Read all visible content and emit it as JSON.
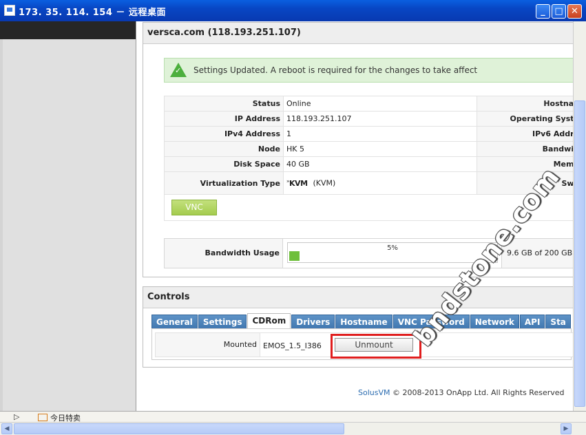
{
  "window": {
    "title": "173. 35. 114. 154 － 远程桌面"
  },
  "server": {
    "heading": "versca.com (118.193.251.107)"
  },
  "alert": {
    "message": "Settings Updated. A reboot is required for the changes to take affect"
  },
  "info_rows": [
    {
      "label": "Status",
      "value": "Online",
      "right_label": "Hostnan"
    },
    {
      "label": "IP Address",
      "value": "118.193.251.107",
      "right_label": "Operating Syste"
    },
    {
      "label": "IPv4 Address",
      "value": "1",
      "right_label": "IPv6 Addre"
    },
    {
      "label": "Node",
      "value": "HK 5",
      "right_label": "Bandwid"
    },
    {
      "label": "Disk Space",
      "value": "40 GB",
      "right_label": "Memo"
    },
    {
      "label": "Virtualization Type",
      "value": "(KVM)",
      "logo": "KVM",
      "right_label": "Swa"
    }
  ],
  "vnc": {
    "label": "VNC"
  },
  "bandwidth": {
    "label": "Bandwidth Usage",
    "percent_text": "5%",
    "percent": 5,
    "usage": "9.6 GB of 200 GB"
  },
  "controls": {
    "title": "Controls",
    "tabs": [
      "General",
      "Settings",
      "CDRom",
      "Drivers",
      "Hostname",
      "VNC Password",
      "Network",
      "API",
      "Sta"
    ],
    "active_tab": 2,
    "cdrom": {
      "label": "Mounted",
      "iso": "EMOS_1.5_I386",
      "button": "Unmount"
    }
  },
  "footer": {
    "link": "SolusVM",
    "text": "© 2008-2013 OnApp Ltd. All Rights Reserved"
  },
  "statusbar": {
    "item": "今日特卖"
  },
  "watermark": "bndstone.com",
  "icons": {
    "app": "remote-desktop-icon",
    "success": "check-triangle-icon"
  }
}
